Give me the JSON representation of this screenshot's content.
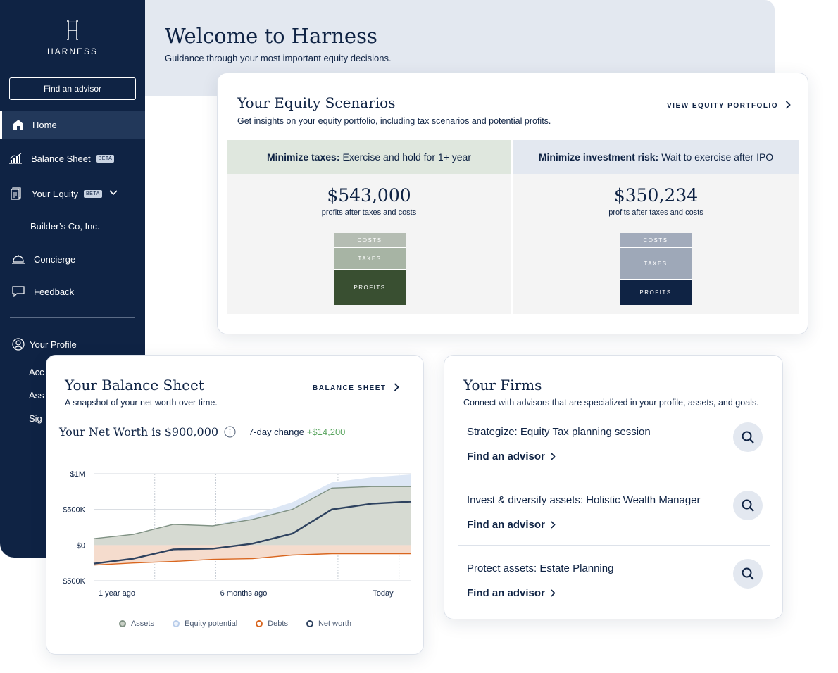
{
  "brand": {
    "name": "HARNESS"
  },
  "sidebar": {
    "find_advisor": "Find an advisor",
    "items": [
      {
        "label": "Home",
        "icon": "home-icon",
        "active": true
      },
      {
        "label": "Balance Sheet",
        "icon": "chart-icon",
        "badge": "BETA"
      },
      {
        "label": "Your Equity",
        "icon": "document-icon",
        "badge": "BETA"
      },
      {
        "label": "Concierge",
        "icon": "bell-icon"
      },
      {
        "label": "Feedback",
        "icon": "message-icon"
      }
    ],
    "equity_sub": "Builder’s Co, Inc.",
    "profile": {
      "label": "Your Profile",
      "sub": [
        "Acc",
        "Ass",
        "Sig"
      ]
    }
  },
  "header": {
    "title": "Welcome to Harness",
    "subtitle": "Guidance through your most important equity decisions."
  },
  "equity": {
    "title": "Your Equity Scenarios",
    "subtitle": "Get insights on your equity portfolio, including tax scenarios and potential profits.",
    "link": "VIEW EQUITY PORTFOLIO",
    "scenarios": [
      {
        "bold": "Minimize taxes:",
        "text": "Exercise and hold for 1+ year",
        "amount": "$543,000",
        "caption": "profits after taxes and costs",
        "header_color": "#dfe7de",
        "segments": [
          {
            "label": "COSTS",
            "color": "#b5bdb3"
          },
          {
            "label": "TAXES",
            "color": "#a7b4a4"
          },
          {
            "label": "PROFITS",
            "color": "#394f31"
          }
        ]
      },
      {
        "bold": "Minimize investment risk:",
        "text": "Wait to exercise after IPO",
        "amount": "$350,234",
        "caption": "profits after taxes and costs",
        "header_color": "#e3e8f0",
        "segments": [
          {
            "label": "COSTS",
            "color": "#a2abbb"
          },
          {
            "label": "TAXES",
            "color": "#9ea8b8"
          },
          {
            "label": "PROFITS",
            "color": "#0f2344"
          }
        ]
      }
    ]
  },
  "balance": {
    "title": "Your Balance Sheet",
    "subtitle": "A snapshot of your net worth over time.",
    "link": "BALANCE SHEET",
    "net_worth": "Your Net Worth is $900,000",
    "change_label": "7-day change",
    "change_value": "+$14,200"
  },
  "chart_data": {
    "type": "area",
    "x": [
      "1 year ago",
      "",
      "",
      "6 months ago",
      "",
      "",
      "",
      "Today"
    ],
    "y_ticks": [
      "$1M",
      "$500K",
      "$0",
      "$500K"
    ],
    "ylim": [
      -500000,
      1000000
    ],
    "series": [
      {
        "name": "Assets",
        "color": "#7f9183",
        "values": [
          90000,
          150000,
          290000,
          270000,
          360000,
          500000,
          800000,
          820000,
          820000
        ]
      },
      {
        "name": "Equity potential",
        "color": "#b9cdea",
        "values": [
          90000,
          150000,
          290000,
          270000,
          420000,
          600000,
          880000,
          950000,
          990000
        ]
      },
      {
        "name": "Debts",
        "color": "#d9661f",
        "values": [
          -280000,
          -250000,
          -230000,
          -200000,
          -190000,
          -140000,
          -120000,
          -120000,
          -120000
        ]
      },
      {
        "name": "Net worth",
        "color": "#2e425f",
        "values": [
          -260000,
          -190000,
          -60000,
          -50000,
          20000,
          160000,
          500000,
          580000,
          610000
        ]
      }
    ],
    "legend": [
      "Assets",
      "Equity potential",
      "Debts",
      "Net worth"
    ]
  },
  "firms": {
    "title": "Your Firms",
    "subtitle": "Connect with advisors that are specialized in your profile, assets, and goals.",
    "items": [
      {
        "title": "Strategize: Equity Tax planning session",
        "link": "Find an advisor"
      },
      {
        "title": "Invest & diversify assets: Holistic Wealth Manager",
        "link": "Find an advisor"
      },
      {
        "title": "Protect assets: Estate Planning",
        "link": "Find an advisor"
      }
    ]
  }
}
